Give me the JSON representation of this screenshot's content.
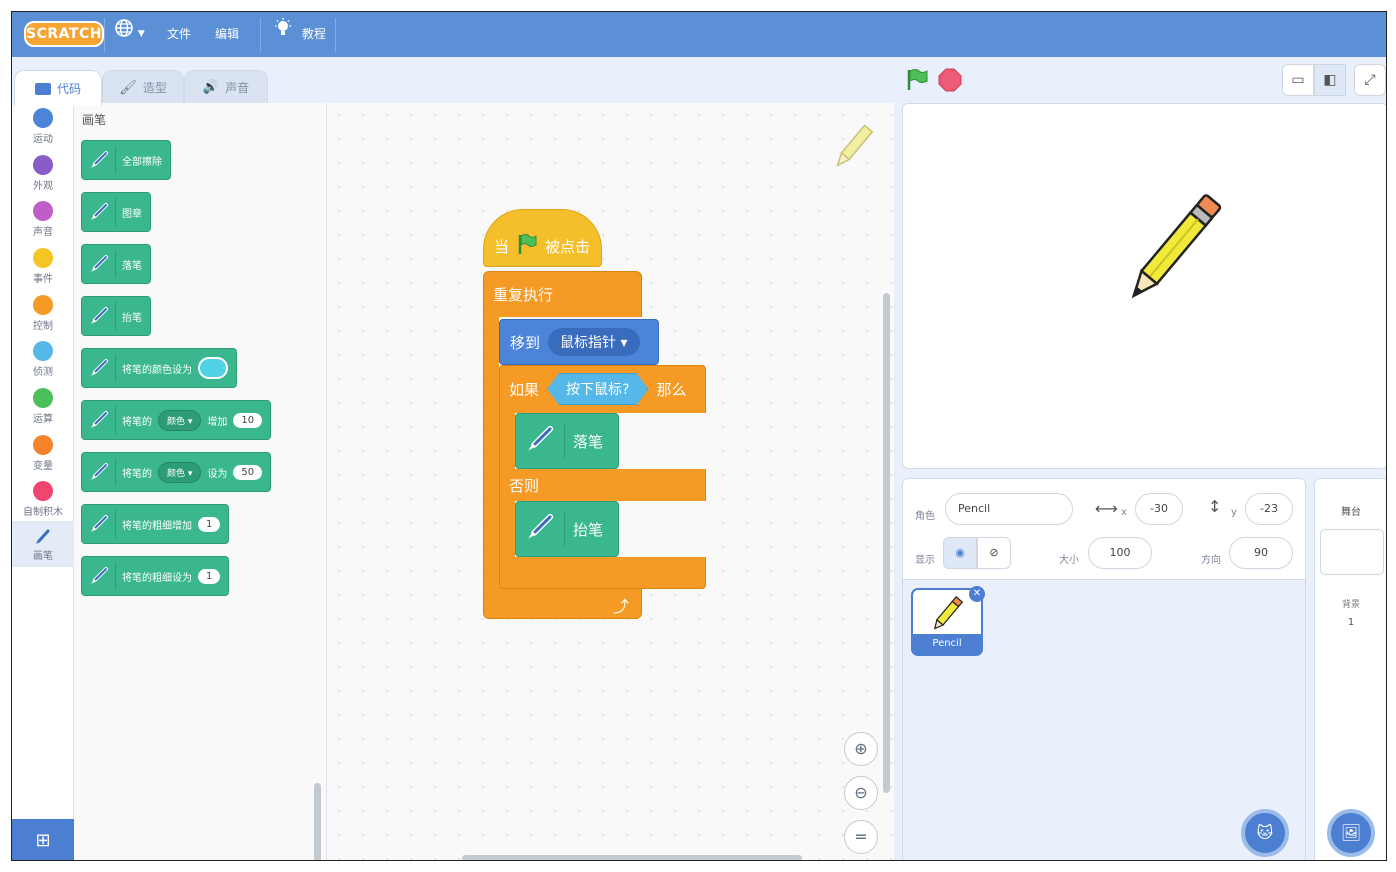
{
  "menubar": {
    "logo": "SCRATCH",
    "file": "文件",
    "edit": "编辑",
    "tutorials": "教程"
  },
  "tabs": [
    {
      "label": "代码",
      "active": true
    },
    {
      "label": "造型",
      "active": false
    },
    {
      "label": "声音",
      "active": false
    }
  ],
  "categories": [
    {
      "label": "运动",
      "color": "#4c84d9"
    },
    {
      "label": "外观",
      "color": "#8a5cc9"
    },
    {
      "label": "声音",
      "color": "#c15dc9"
    },
    {
      "label": "事件",
      "color": "#f5c524"
    },
    {
      "label": "控制",
      "color": "#f59a25"
    },
    {
      "label": "侦测",
      "color": "#56b8e8"
    },
    {
      "label": "运算",
      "color": "#4bbf5a"
    },
    {
      "label": "变量",
      "color": "#f5832b"
    },
    {
      "label": "自制积木",
      "color": "#f0456e"
    },
    {
      "label": "画笔",
      "color": "#3ab78e"
    }
  ],
  "palette": {
    "title": "画笔",
    "blocks": {
      "clear": "全部擦除",
      "stamp": "图章",
      "pen_down": "落笔",
      "pen_up": "抬笔",
      "set_color_to": "将笔的颜色设为",
      "change_param_prefix": "将笔的",
      "change_param_dropdown": "颜色",
      "change_param_mid": "增加",
      "change_param_value": "10",
      "set_param_prefix": "将笔的",
      "set_param_dropdown": "颜色",
      "set_param_mid": "设为",
      "set_param_value": "50",
      "change_size": "将笔的粗细增加",
      "change_size_value": "1",
      "set_size": "将笔的粗细设为",
      "set_size_value": "1"
    }
  },
  "script": {
    "hat_when": "当",
    "hat_clicked": "被点击",
    "forever": "重复执行",
    "goto": "移到",
    "goto_target": "鼠标指针",
    "if": "如果",
    "condition": "按下鼠标?",
    "then": "那么",
    "pen_down": "落笔",
    "else": "否则",
    "pen_up": "抬笔"
  },
  "sprite_info": {
    "sprite_label": "角色",
    "sprite_name": "Pencil",
    "x_label": "x",
    "x_value": "-30",
    "y_label": "y",
    "y_value": "-23",
    "show_label": "显示",
    "size_label": "大小",
    "size_value": "100",
    "direction_label": "方向",
    "direction_value": "90"
  },
  "sprites": [
    {
      "name": "Pencil",
      "selected": true
    }
  ],
  "stage_panel": {
    "title": "舞台",
    "backdrop_label": "背景",
    "backdrop_count": "1"
  },
  "colors": {
    "menubar": "#5b8fd6",
    "pen_block": "#3ab78e",
    "control_block": "#f59a25",
    "event_block": "#f5be2b",
    "motion_block": "#4c84d9",
    "sensing_block": "#56b8e8"
  }
}
